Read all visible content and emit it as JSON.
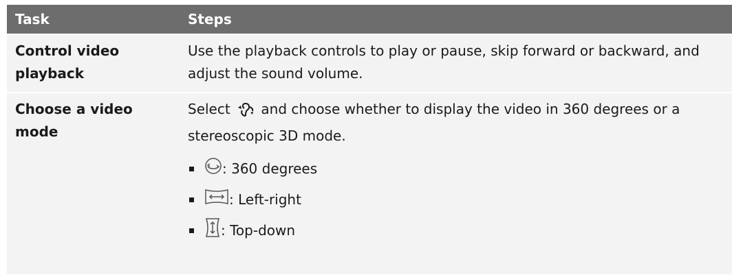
{
  "header": {
    "task": "Task",
    "steps": "Steps"
  },
  "rows": [
    {
      "task": "Control video playback",
      "steps": "Use the playback controls to play or pause, skip forward or backward, and adjust the sound volume."
    },
    {
      "task": "Choose a video mode",
      "steps_before_icon": "Select",
      "steps_icon": "rotate-360-icon",
      "steps_after_icon": "and choose whether to display the video in 360 degrees or a stereoscopic 3D mode.",
      "options": [
        {
          "icon": "sphere-360-icon",
          "label": ": 360 degrees"
        },
        {
          "icon": "left-right-icon",
          "label": ": Left-right"
        },
        {
          "icon": "top-down-icon",
          "label": ": Top-down"
        }
      ]
    }
  ]
}
